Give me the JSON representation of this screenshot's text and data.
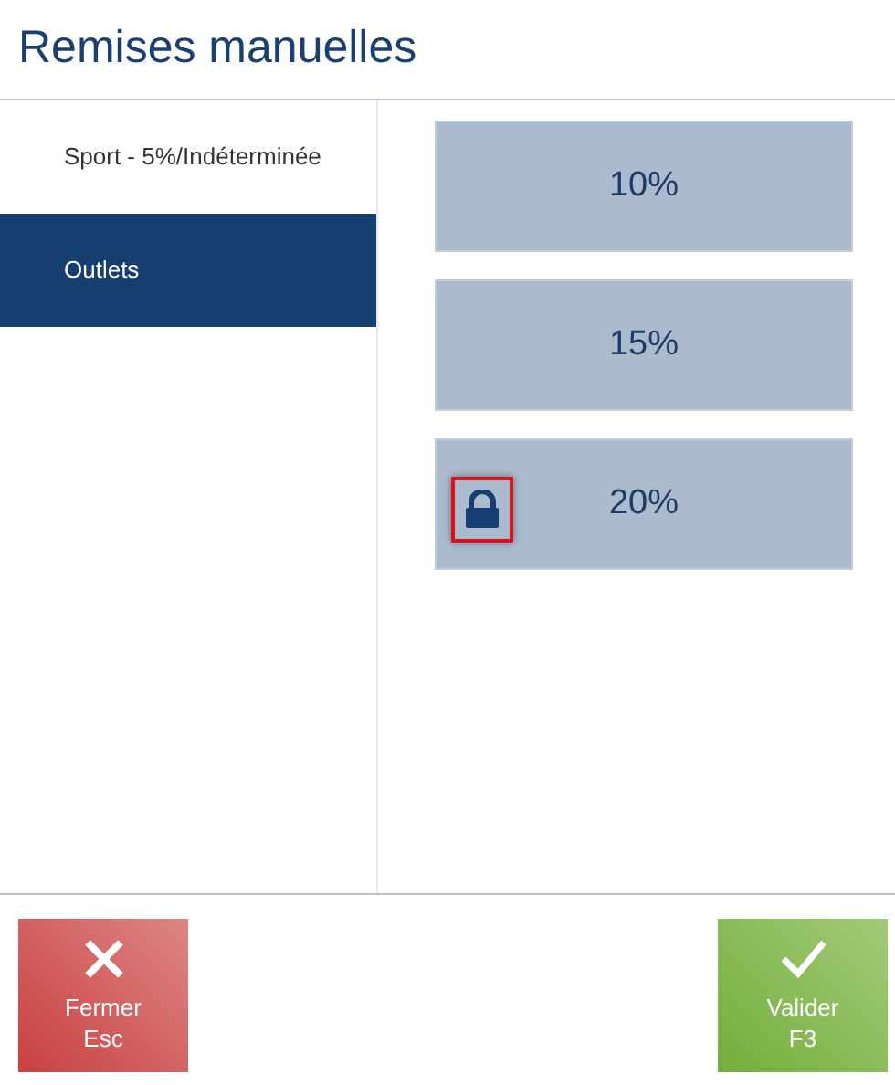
{
  "title": "Remises manuelles",
  "categories": [
    {
      "label": "Sport - 5%/Indéterminée",
      "selected": false
    },
    {
      "label": "Outlets",
      "selected": true
    }
  ],
  "discounts": [
    {
      "label": "10%",
      "locked": false
    },
    {
      "label": "15%",
      "locked": false
    },
    {
      "label": "20%",
      "locked": true
    }
  ],
  "buttons": [
    {
      "kind": "close",
      "label": "Fermer",
      "shortcut": "Esc"
    },
    {
      "kind": "confirm",
      "label": "Valider",
      "shortcut": "F3"
    }
  ]
}
